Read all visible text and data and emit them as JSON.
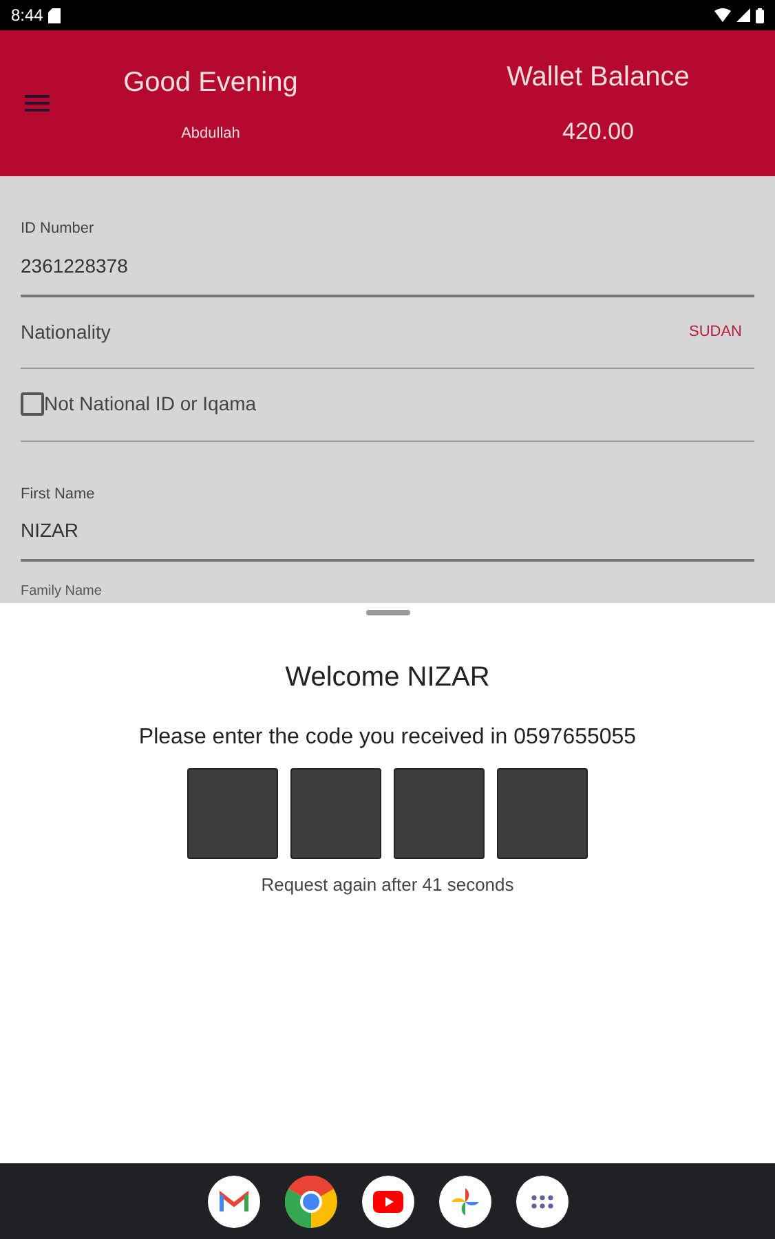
{
  "status_bar": {
    "time": "8:44"
  },
  "header": {
    "greeting": "Good Evening",
    "user_name": "Abdullah",
    "wallet_label": "Wallet Balance",
    "wallet_amount": "420.00"
  },
  "form": {
    "fields": [
      {
        "kind": "text",
        "label": "ID Number",
        "value": "2361228378"
      },
      {
        "kind": "select",
        "label": "Nationality",
        "value": "SUDAN"
      },
      {
        "kind": "checkbox",
        "label": "Not National ID or Iqama",
        "checked": false
      },
      {
        "kind": "text",
        "label": "First Name",
        "value": "NIZAR"
      },
      {
        "kind": "label",
        "label": "Family Name"
      }
    ]
  },
  "sheet": {
    "title": "Welcome NIZAR",
    "prompt": "Please enter the code you received in 0597655055",
    "code_boxes": [
      {
        "filled": false
      },
      {
        "filled": false
      },
      {
        "filled": false
      },
      {
        "filled": false
      }
    ],
    "resend_note": "Request again after 41 seconds"
  },
  "dock": [
    {
      "kind": "mail"
    },
    {
      "kind": "browser"
    },
    {
      "kind": "video"
    },
    {
      "kind": "pinwheel"
    },
    {
      "kind": "apps"
    }
  ]
}
